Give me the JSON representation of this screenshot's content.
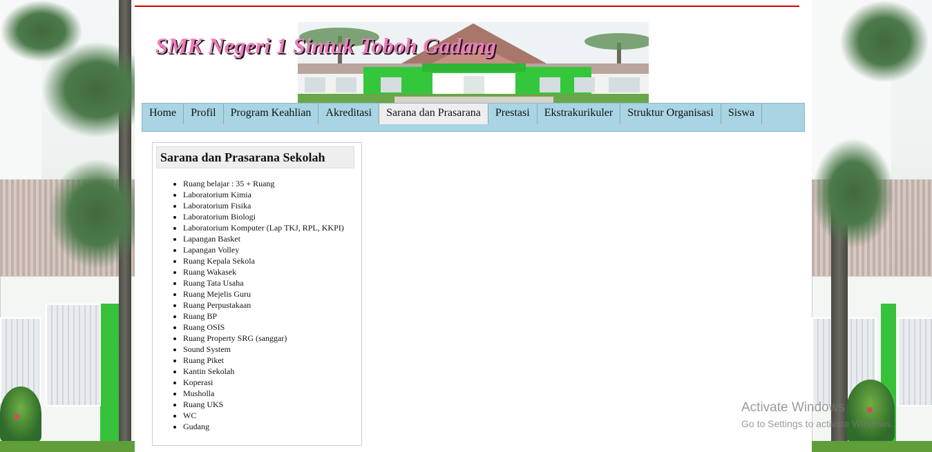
{
  "header": {
    "title": "SMK Negeri 1 Sintuk Toboh Gadang"
  },
  "nav": {
    "items": [
      {
        "label": "Home"
      },
      {
        "label": "Profil"
      },
      {
        "label": "Program Keahlian"
      },
      {
        "label": "Akreditasi"
      },
      {
        "label": "Sarana dan Prasarana",
        "active": true
      },
      {
        "label": "Prestasi"
      },
      {
        "label": "Ekstrakurikuler"
      },
      {
        "label": "Struktur Organisasi"
      },
      {
        "label": "Siswa"
      }
    ]
  },
  "content": {
    "heading": "Sarana dan Prasarana Sekolah",
    "facilities": [
      "Ruang belajar : 35 + Ruang",
      "Laboratorium Kimia",
      "Laboratorium Fisika",
      "Laboratorium Biologi",
      "Laboratorium Komputer (Lap TKJ, RPL, KKPI)",
      "Lapangan Basket",
      "Lapangan Volley",
      "Ruang Kepala Sekola",
      "Ruang Wakasek",
      "Ruang Tata Usaha",
      "Ruang Mejelis Guru",
      "Ruang Perpustakaan",
      "Ruang BP",
      "Ruang OSIS",
      "Ruang Property SRG (sanggar)",
      "Sound System",
      "Ruang Piket",
      "Kantin Sekolah",
      "Koperasi",
      "Musholla",
      "Ruang UKS",
      "WC",
      "Gudang"
    ]
  },
  "watermark": {
    "line1": "Activate Windows",
    "line2": "Go to Settings to activate Windows."
  },
  "colors": {
    "nav_bg": "#a8d4e4",
    "active_tab": "#eeeeee",
    "title_pink": "#f07bbd",
    "top_line": "#d40000"
  }
}
